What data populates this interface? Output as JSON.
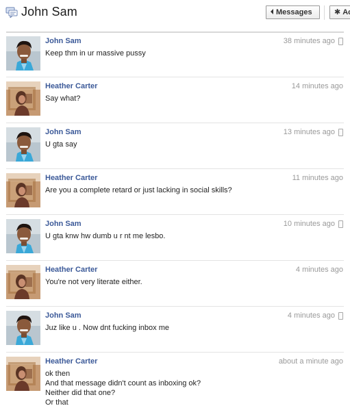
{
  "header": {
    "title": "John Sam",
    "messages_button": "Messages",
    "actions_button": "Ac"
  },
  "messages": [
    {
      "author": "John Sam",
      "time": "38 minutes ago",
      "mobile": true,
      "lines": [
        "Keep thm in ur massive pussy"
      ]
    },
    {
      "author": "Heather Carter",
      "time": "14 minutes ago",
      "mobile": false,
      "lines": [
        "Say what?"
      ]
    },
    {
      "author": "John Sam",
      "time": "13 minutes ago",
      "mobile": true,
      "lines": [
        "U gta say"
      ]
    },
    {
      "author": "Heather Carter",
      "time": "11 minutes ago",
      "mobile": false,
      "lines": [
        "Are you a complete retard or just lacking in social skills?"
      ]
    },
    {
      "author": "John Sam",
      "time": "10 minutes ago",
      "mobile": true,
      "lines": [
        "U gta knw hw dumb u r nt me lesbo."
      ]
    },
    {
      "author": "Heather Carter",
      "time": "4 minutes ago",
      "mobile": false,
      "lines": [
        "You're not very literate either."
      ]
    },
    {
      "author": "John Sam",
      "time": "4 minutes ago",
      "mobile": true,
      "lines": [
        "Juz like u . Now dnt fucking inbox me"
      ]
    },
    {
      "author": "Heather Carter",
      "time": "about a minute ago",
      "mobile": false,
      "lines": [
        "ok then",
        "And that message didn't count as inboxing ok?",
        "Neither did that one?",
        "Or that"
      ]
    }
  ]
}
